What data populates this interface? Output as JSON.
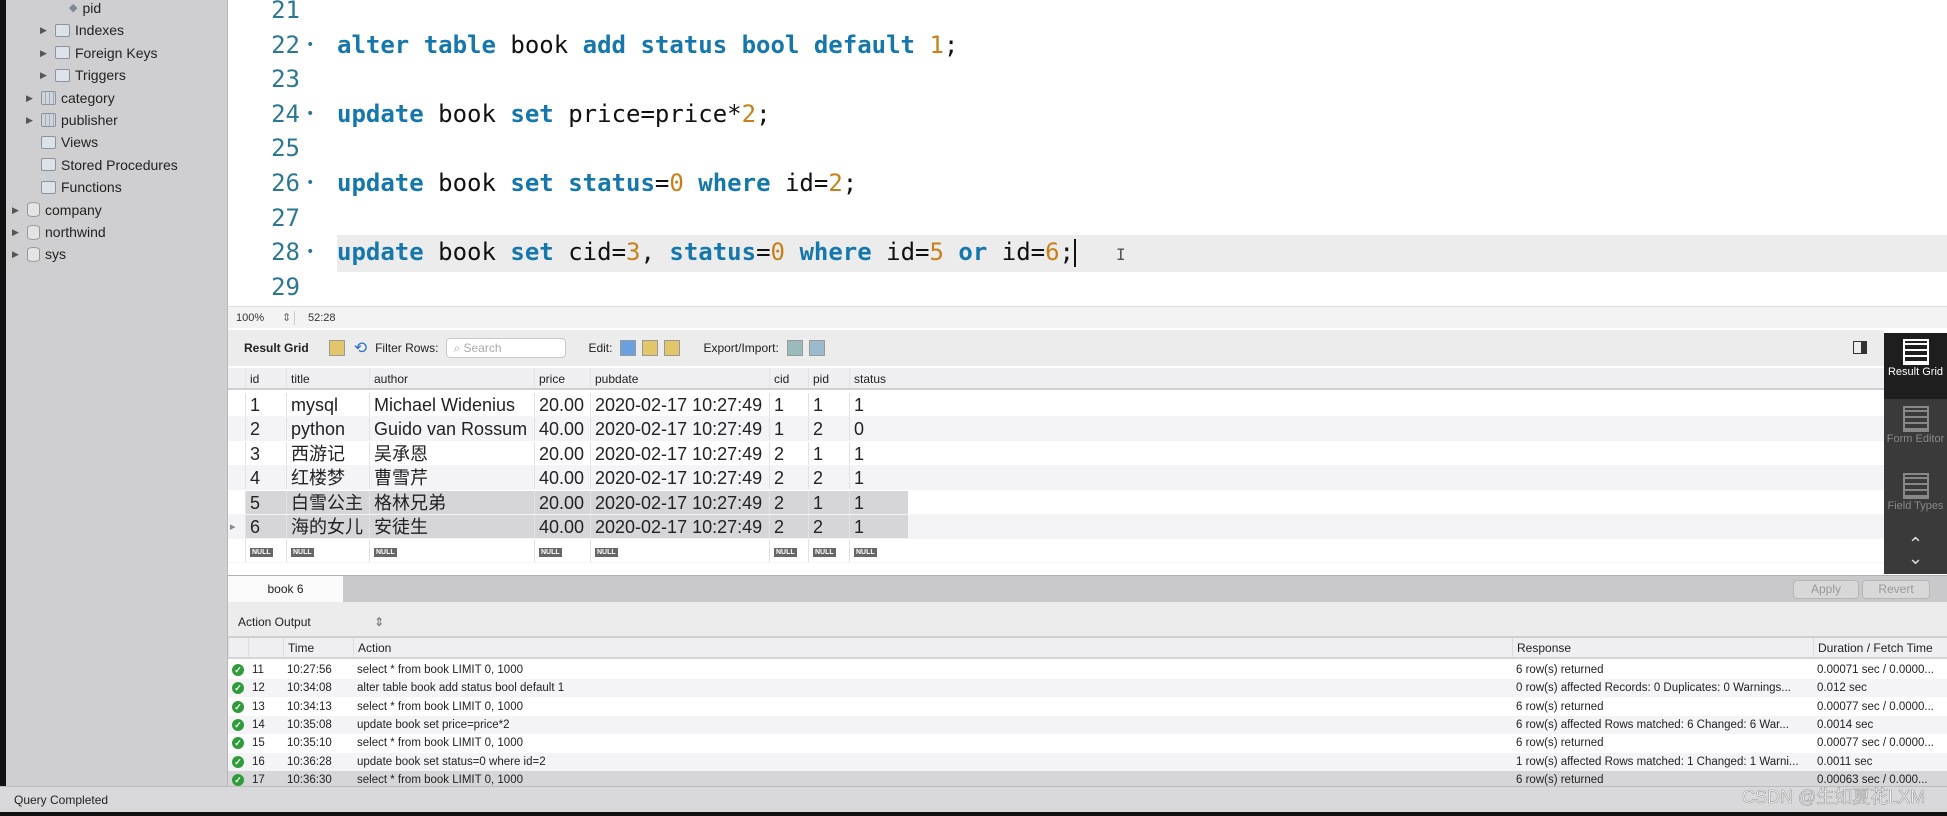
{
  "sidebar": {
    "items": [
      {
        "label": "pid",
        "icon": "column-diamond-icon",
        "indent": 3,
        "arrow": false
      },
      {
        "label": "Indexes",
        "icon": "folder-icon",
        "indent": 2,
        "arrow": true
      },
      {
        "label": "Foreign Keys",
        "icon": "folder-icon",
        "indent": 2,
        "arrow": true
      },
      {
        "label": "Triggers",
        "icon": "folder-icon",
        "indent": 2,
        "arrow": true
      },
      {
        "label": "category",
        "icon": "table-icon",
        "indent": 1,
        "arrow": true
      },
      {
        "label": "publisher",
        "icon": "table-icon",
        "indent": 1,
        "arrow": true
      },
      {
        "label": "Views",
        "icon": "folder-icon",
        "indent": 1,
        "arrow": false
      },
      {
        "label": "Stored Procedures",
        "icon": "folder-icon",
        "indent": 1,
        "arrow": false
      },
      {
        "label": "Functions",
        "icon": "folder-icon",
        "indent": 1,
        "arrow": false
      },
      {
        "label": "company",
        "icon": "database-icon",
        "indent": 0,
        "arrow": true
      },
      {
        "label": "northwind",
        "icon": "database-icon",
        "indent": 0,
        "arrow": true
      },
      {
        "label": "sys",
        "icon": "database-icon",
        "indent": 0,
        "arrow": true
      }
    ]
  },
  "editor": {
    "lines": [
      {
        "n": "21",
        "tokens": []
      },
      {
        "n": "22",
        "tokens": [
          [
            "kw",
            "alter table"
          ],
          [
            "id",
            " book "
          ],
          [
            "kw",
            "add status bool default"
          ],
          [
            "id",
            " "
          ],
          [
            "num",
            "1"
          ],
          [
            "id",
            ";"
          ]
        ]
      },
      {
        "n": "23",
        "tokens": []
      },
      {
        "n": "24",
        "tokens": [
          [
            "kw",
            "update"
          ],
          [
            "id",
            " book "
          ],
          [
            "kw",
            "set"
          ],
          [
            "id",
            " price=price*"
          ],
          [
            "num",
            "2"
          ],
          [
            "id",
            ";"
          ]
        ]
      },
      {
        "n": "25",
        "tokens": []
      },
      {
        "n": "26",
        "tokens": [
          [
            "kw",
            "update"
          ],
          [
            "id",
            " book "
          ],
          [
            "kw",
            "set status"
          ],
          [
            "id",
            "="
          ],
          [
            "num",
            "0"
          ],
          [
            "id",
            " "
          ],
          [
            "kw",
            "where"
          ],
          [
            "id",
            " id="
          ],
          [
            "num",
            "2"
          ],
          [
            "id",
            ";"
          ]
        ]
      },
      {
        "n": "27",
        "tokens": []
      },
      {
        "n": "28",
        "current": true,
        "tokens": [
          [
            "kw",
            "update"
          ],
          [
            "id",
            " book "
          ],
          [
            "kw",
            "set"
          ],
          [
            "id",
            " cid="
          ],
          [
            "num",
            "3"
          ],
          [
            "id",
            ", "
          ],
          [
            "kw",
            "status"
          ],
          [
            "id",
            "="
          ],
          [
            "num",
            "0"
          ],
          [
            "id",
            " "
          ],
          [
            "kw",
            "where"
          ],
          [
            "id",
            " id="
          ],
          [
            "num",
            "5"
          ],
          [
            "id",
            " "
          ],
          [
            "kw",
            "or"
          ],
          [
            "id",
            " id="
          ],
          [
            "num",
            "6"
          ],
          [
            "id",
            ";"
          ]
        ]
      },
      {
        "n": "29",
        "tokens": []
      }
    ],
    "zoom": "100%",
    "cursor_pos": "52:28"
  },
  "result_toolbar": {
    "title": "Result Grid",
    "filter_label": "Filter Rows:",
    "search_placeholder": "Search",
    "edit_label": "Edit:",
    "export_label": "Export/Import:"
  },
  "grid": {
    "columns": [
      "id",
      "title",
      "author",
      "price",
      "pubdate",
      "cid",
      "pid",
      "status"
    ],
    "rows": [
      [
        "1",
        "mysql",
        "Michael Widenius",
        "20.00",
        "2020-02-17 10:27:49",
        "1",
        "1",
        "1"
      ],
      [
        "2",
        "python",
        "Guido van Rossum",
        "40.00",
        "2020-02-17 10:27:49",
        "1",
        "2",
        "0"
      ],
      [
        "3",
        "西游记",
        "吴承恩",
        "20.00",
        "2020-02-17 10:27:49",
        "2",
        "1",
        "1"
      ],
      [
        "4",
        "红楼梦",
        "曹雪芹",
        "40.00",
        "2020-02-17 10:27:49",
        "2",
        "2",
        "1"
      ],
      [
        "5",
        "白雪公主",
        "格林兄弟",
        "20.00",
        "2020-02-17 10:27:49",
        "2",
        "1",
        "1"
      ],
      [
        "6",
        "海的女儿",
        "安徒生",
        "40.00",
        "2020-02-17 10:27:49",
        "2",
        "2",
        "1"
      ]
    ],
    "selected_rows": [
      4,
      5
    ],
    "null_label": "NULL"
  },
  "right_panel": {
    "items": [
      "Result Grid",
      "Form Editor",
      "Field Types"
    ]
  },
  "tabs": {
    "result_tab": "book 6",
    "apply": "Apply",
    "revert": "Revert"
  },
  "action_output": {
    "title": "Action Output",
    "columns": [
      "",
      "",
      "Time",
      "Action",
      "Response",
      "Duration / Fetch Time"
    ],
    "rows": [
      [
        "11",
        "10:27:56",
        "select * from book LIMIT 0, 1000",
        "6 row(s) returned",
        "0.00071 sec / 0.0000..."
      ],
      [
        "12",
        "10:34:08",
        "alter table book add status bool default 1",
        "0 row(s) affected Records: 0  Duplicates: 0  Warnings...",
        "0.012 sec"
      ],
      [
        "13",
        "10:34:13",
        "select * from book LIMIT 0, 1000",
        "6 row(s) returned",
        "0.00077 sec / 0.0000..."
      ],
      [
        "14",
        "10:35:08",
        "update book set price=price*2",
        "6 row(s) affected Rows matched: 6  Changed: 6  War...",
        "0.0014 sec"
      ],
      [
        "15",
        "10:35:10",
        "select * from book LIMIT 0, 1000",
        "6 row(s) returned",
        "0.00077 sec / 0.0000..."
      ],
      [
        "16",
        "10:36:28",
        "update book set status=0 where id=2",
        "1 row(s) affected Rows matched: 1  Changed: 1  Warni...",
        "0.0011 sec"
      ],
      [
        "17",
        "10:36:30",
        "select * from book LIMIT 0, 1000",
        "6 row(s) returned",
        "0.00063 sec / 0.000..."
      ]
    ]
  },
  "status": "Query Completed",
  "watermark": "CSDN @生如夏花LXM",
  "colors": {
    "keyword": "#1577ab",
    "number": "#c8801a",
    "success": "#2f9b3a"
  }
}
